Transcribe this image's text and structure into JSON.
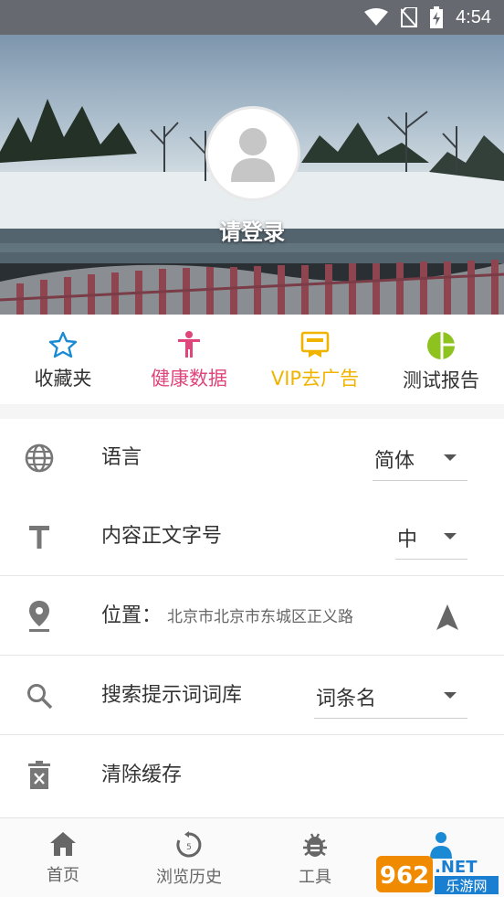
{
  "status_bar": {
    "time": "4:54"
  },
  "header": {
    "login_text": "请登录"
  },
  "quick_actions": [
    {
      "label": "收藏夹",
      "icon": "star-icon",
      "color": "#1a8ad4"
    },
    {
      "label": "健康数据",
      "icon": "person-icon",
      "color": "#e0457b"
    },
    {
      "label": "VIP去广告",
      "icon": "vip-ticket-icon",
      "color": "#f0b400"
    },
    {
      "label": "测试报告",
      "icon": "pie-chart-icon",
      "color": "#8dc21f"
    }
  ],
  "settings": {
    "language": {
      "label": "语言",
      "value": "简体"
    },
    "font_size": {
      "label": "内容正文字号",
      "value": "中"
    },
    "location": {
      "label": "位置：",
      "value": "北京市北京市东城区正义路"
    },
    "search_lexicon": {
      "label": "搜索提示词词库",
      "value": "词条名"
    },
    "clear_cache": {
      "label": "清除缓存"
    }
  },
  "bottom_nav": [
    {
      "label": "首页",
      "icon": "home-icon"
    },
    {
      "label": "浏览历史",
      "icon": "history-icon"
    },
    {
      "label": "工具",
      "icon": "bug-tool-icon"
    },
    {
      "label": "",
      "icon": "profile-icon"
    }
  ],
  "watermark": {
    "text": "962",
    "suffix": ".NET",
    "sub": "乐游网"
  }
}
